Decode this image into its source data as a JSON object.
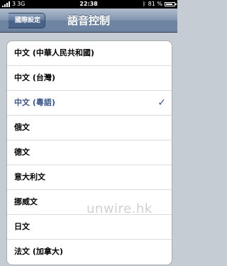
{
  "status": {
    "carrier": "3",
    "network": "3G",
    "time": "22:38",
    "battery": "81 %",
    "battery_level": 0.81
  },
  "nav": {
    "back_label": "國際設定",
    "title": "語音控制"
  },
  "languages": [
    {
      "label": "中文 (中華人民共和國)",
      "selected": false
    },
    {
      "label": "中文 (台灣)",
      "selected": false
    },
    {
      "label": "中文 (粵語)",
      "selected": true
    },
    {
      "label": "俄文",
      "selected": false
    },
    {
      "label": "德文",
      "selected": false
    },
    {
      "label": "意大利文",
      "selected": false
    },
    {
      "label": "挪威文",
      "selected": false
    },
    {
      "label": "日文",
      "selected": false
    },
    {
      "label": "法文 (加拿大)",
      "selected": false
    }
  ],
  "check_mark": "✓",
  "watermark": "unwire.hk",
  "colors": {
    "selected_text": "#385487",
    "nav_bar": "#6d84a2",
    "background": "#c5ccd4"
  }
}
